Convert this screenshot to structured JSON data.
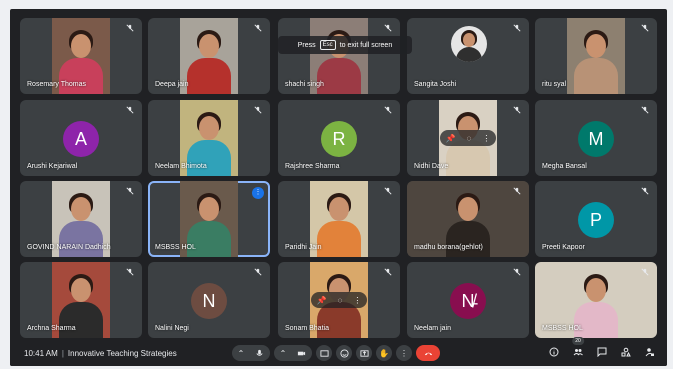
{
  "toast": {
    "prefix": "Press",
    "key": "Esc",
    "suffix": "to exit full screen"
  },
  "participants": [
    {
      "name": "Rosemary Thomas",
      "type": "video",
      "bg": "#7b5a4a",
      "body": "#c8405b"
    },
    {
      "name": "Deepa jain",
      "type": "video",
      "bg": "#a8a39a",
      "body": "#b5312c"
    },
    {
      "name": "shachi singh",
      "type": "video",
      "bg": "#8c7e77",
      "body": "#9c3a45"
    },
    {
      "name": "Sangita Joshi",
      "type": "video-small",
      "bg": "#e5e5e5",
      "body": "#2f2f2f"
    },
    {
      "name": "ritu syal",
      "type": "video",
      "bg": "#8d8070",
      "body": "#b89276"
    },
    {
      "name": "Arushi Kejariwal",
      "type": "avatar",
      "letter": "A",
      "color": "#8e24aa"
    },
    {
      "name": "Neelam Bhimota",
      "type": "video",
      "bg": "#c1b47e",
      "body": "#30a2b9"
    },
    {
      "name": "Rajshree Sharma",
      "type": "avatar",
      "letter": "R",
      "color": "#7cb342"
    },
    {
      "name": "Nidhi Dave",
      "type": "video",
      "bg": "#d9d1c3",
      "body": "#d7c8b0"
    },
    {
      "name": "Megha Bansal",
      "type": "avatar",
      "letter": "M",
      "color": "#00796b"
    },
    {
      "name": "GOVIND NARAIN Dadhich",
      "type": "video",
      "bg": "#c8c3b9",
      "body": "#7a74a1"
    },
    {
      "name": "MSBSS HOL",
      "type": "video",
      "bg": "#6a5a4c",
      "body": "#3a7d63"
    },
    {
      "name": "Paridhi Jain",
      "type": "video",
      "bg": "#d4c7a8",
      "body": "#e2823a"
    },
    {
      "name": "madhu borana(gehlot)",
      "type": "video-wide",
      "bg": "#4e463f",
      "body": "#2a2420"
    },
    {
      "name": "Preeti Kapoor",
      "type": "avatar",
      "letter": "P",
      "color": "#0097a7"
    },
    {
      "name": "Archna Sharma",
      "type": "video",
      "bg": "#a54a3c",
      "body": "#2b2b2b"
    },
    {
      "name": "Nalini Negi",
      "type": "avatar",
      "letter": "N",
      "color": "#6d4c41"
    },
    {
      "name": "Sonam Bhatia",
      "type": "video",
      "bg": "#d9a86a",
      "body": "#8a3a2a"
    },
    {
      "name": "Neelam jain",
      "type": "avatar",
      "letter": "N̵̸",
      "color": "#880e4f"
    },
    {
      "name": "MSBSS HOL",
      "type": "video-wide",
      "bg": "#d4cdbf",
      "body": "#e3b8c8"
    }
  ],
  "bottom_bar": {
    "time": "10:41 AM",
    "separator": "|",
    "meeting_name": "Innovative Teaching Strategies",
    "participant_count": "20"
  },
  "colors": {
    "hangup": "#ea4335",
    "active_border": "#8ab4f8",
    "speaking": "#1a73e8"
  }
}
